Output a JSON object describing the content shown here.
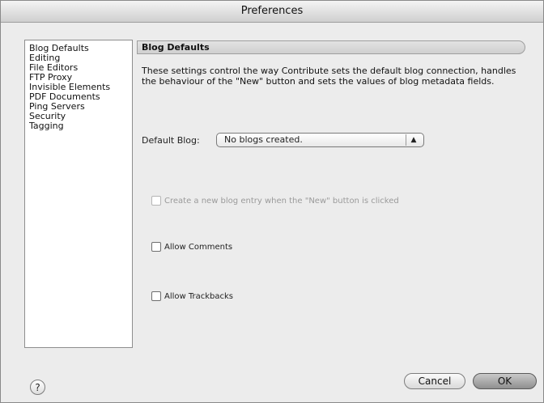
{
  "window": {
    "title": "Preferences"
  },
  "sidebar": {
    "items": [
      {
        "label": "Blog Defaults"
      },
      {
        "label": "Editing"
      },
      {
        "label": "File Editors"
      },
      {
        "label": "FTP Proxy"
      },
      {
        "label": "Invisible Elements"
      },
      {
        "label": "PDF Documents"
      },
      {
        "label": "Ping Servers"
      },
      {
        "label": "Security"
      },
      {
        "label": "Tagging"
      }
    ],
    "selected": "Blog Defaults"
  },
  "panel": {
    "header": "Blog Defaults",
    "description": "These settings control the way Contribute sets the default blog connection, handles the behaviour of the \"New\" button and sets the values of blog metadata fields.",
    "default_blog_label": "Default Blog:",
    "default_blog_value": "No blogs created.",
    "checkboxes": [
      {
        "label": "Create a new blog entry when the \"New\" button is clicked",
        "checked": false,
        "disabled": true
      },
      {
        "label": "Allow Comments",
        "checked": false,
        "disabled": false
      },
      {
        "label": "Allow Trackbacks",
        "checked": false,
        "disabled": false
      }
    ]
  },
  "footer": {
    "help_label": "?",
    "cancel_label": "Cancel",
    "ok_label": "OK"
  }
}
